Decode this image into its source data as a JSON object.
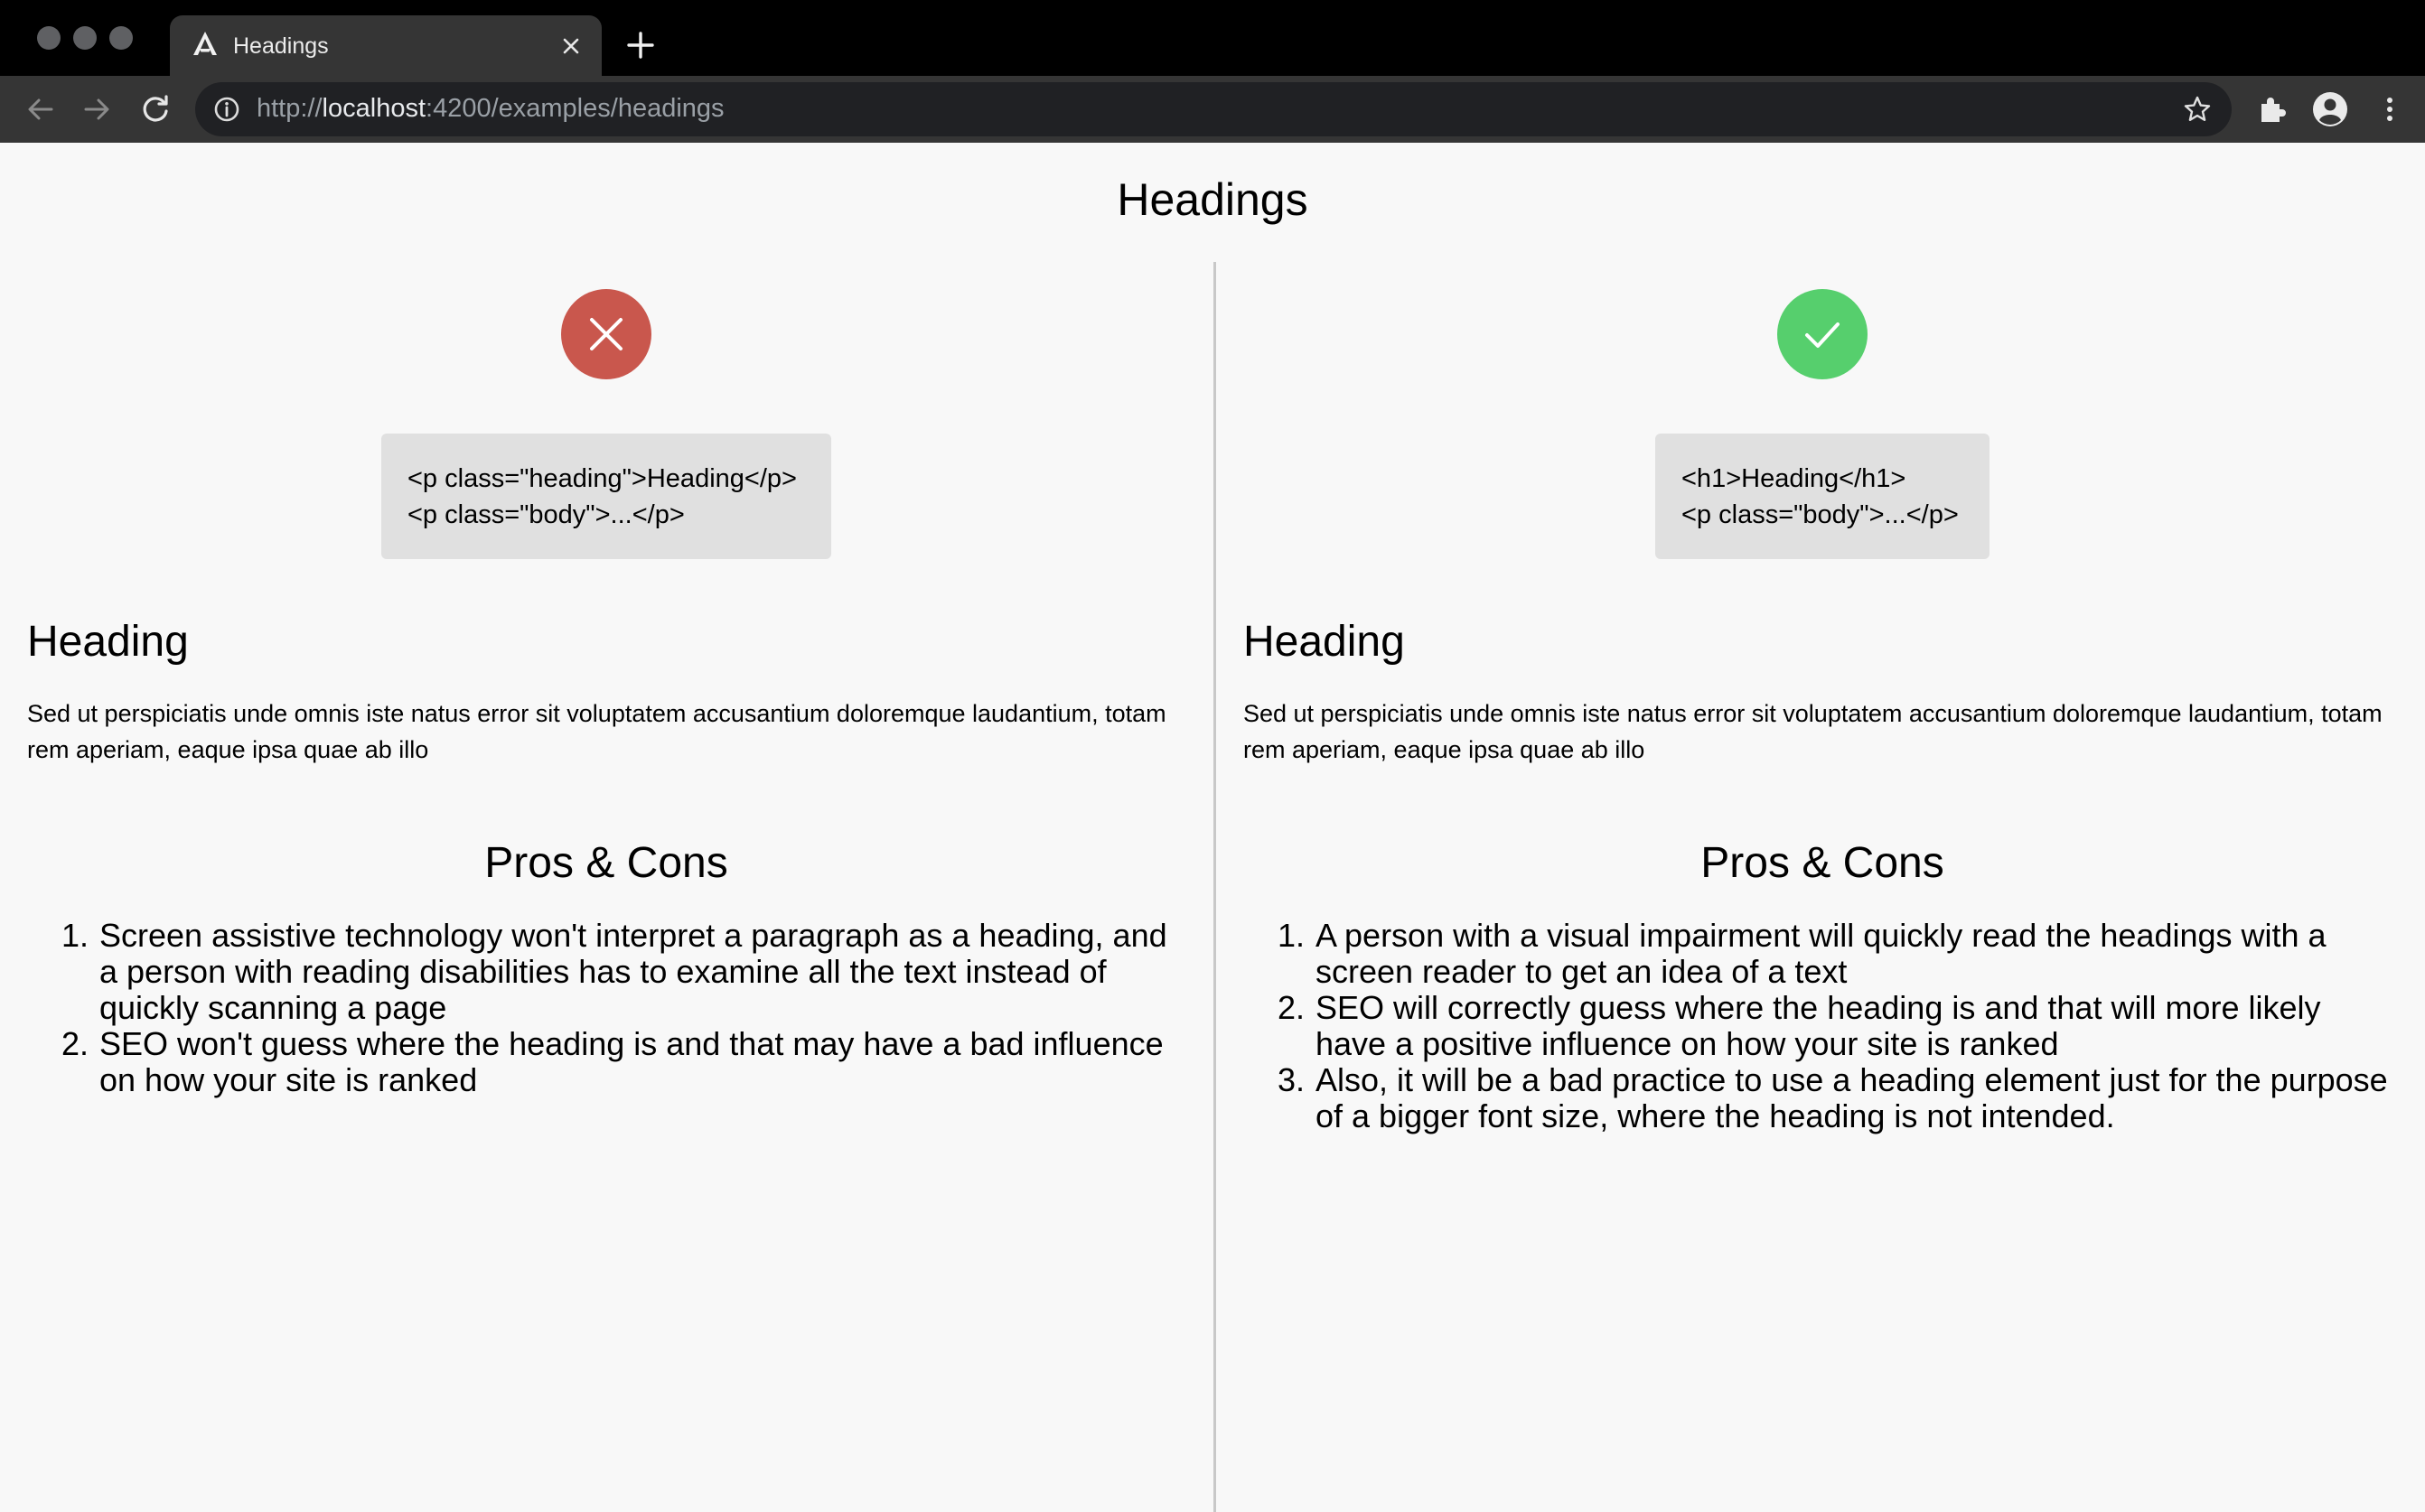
{
  "browser": {
    "tab": {
      "title": "Headings",
      "favicon": "angular-logo-icon"
    },
    "url": {
      "scheme": "http://",
      "host": "localhost",
      "rest": ":4200/examples/headings"
    },
    "icons": [
      "back-arrow-icon",
      "forward-arrow-icon",
      "reload-icon",
      "info-icon",
      "star-icon",
      "extensions-icon",
      "profile-icon",
      "menu-dots-icon"
    ]
  },
  "page": {
    "title": "Headings"
  },
  "left": {
    "status": "bad",
    "status_color": "#c9574d",
    "code_lines": [
      "<p class=\"heading\">Heading</p>",
      "<p class=\"body\">...</p>"
    ],
    "demo_heading": "Heading",
    "demo_body": "Sed ut perspiciatis unde omnis iste natus error sit voluptatem accusantium doloremque laudantium, totam rem aperiam, eaque ipsa quae ab illo",
    "pros_title": "Pros & Cons",
    "items": [
      {
        "num": "1.",
        "text": "Screen assistive technology won't interpret a paragraph as a heading, and a person with reading disabilities has to examine all the text instead of quickly scanning a page"
      },
      {
        "num": "2.",
        "text": "SEO won't guess where the heading is and that may have a bad influence on how your site is ranked"
      }
    ]
  },
  "right": {
    "status": "good",
    "status_color": "#56cf6d",
    "code_lines": [
      "<h1>Heading</h1>",
      "<p class=\"body\">...</p>"
    ],
    "demo_heading": "Heading",
    "demo_body": "Sed ut perspiciatis unde omnis iste natus error sit voluptatem accusantium doloremque laudantium, totam rem aperiam, eaque ipsa quae ab illo",
    "pros_title": "Pros & Cons",
    "items": [
      {
        "num": "1.",
        "text": "A person with a visual impairment will quickly read the headings with a screen reader to get an idea of a text"
      },
      {
        "num": "2.",
        "text": "SEO will correctly guess where the heading is and that will more likely have a positive influence on how your site is ranked"
      },
      {
        "num": "3.",
        "text": "Also, it will be a bad practice to use a heading element just for the purpose of a bigger font size, where the heading is not intended."
      }
    ]
  }
}
